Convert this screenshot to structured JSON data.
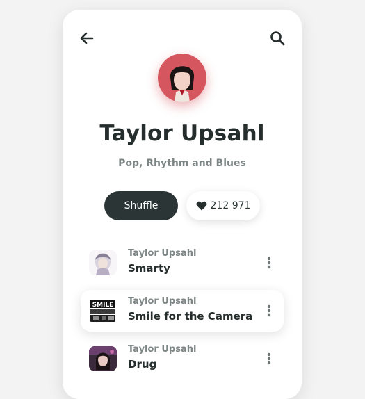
{
  "header": {
    "back_icon": "arrow-left-icon",
    "search_icon": "search-icon"
  },
  "artist": {
    "name": "Taylor Upsahl",
    "genres": "Pop, Rhythm and Blues",
    "avatar": "artist-avatar"
  },
  "actions": {
    "shuffle_label": "Shuffle",
    "likes_icon": "heart-icon",
    "likes_count": "212 971"
  },
  "tracks": [
    {
      "artist": "Taylor Upsahl",
      "title": "Smarty",
      "active": false
    },
    {
      "artist": "Taylor Upsahl",
      "title": "Smile for the Camera",
      "active": true
    },
    {
      "artist": "Taylor Upsahl",
      "title": "Drug",
      "active": false
    }
  ],
  "colors": {
    "background": "#f3f3f3",
    "card": "#ffffff",
    "dark": "#2b3535",
    "muted_text": "#7d8585",
    "avatar_accent": "#d65660"
  }
}
